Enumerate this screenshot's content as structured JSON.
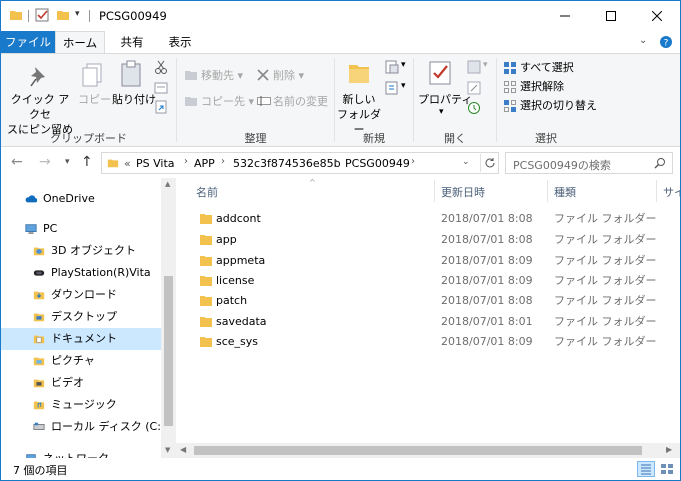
{
  "window": {
    "title": "PCSG00949"
  },
  "tabs": {
    "file": "ファイル",
    "home": "ホーム",
    "share": "共有",
    "view": "表示"
  },
  "ribbon": {
    "clipboard": {
      "pin_line1": "クイック アクセ",
      "pin_line2": "スにピン留め",
      "copy": "コピー",
      "paste": "貼り付け",
      "group": "クリップボード"
    },
    "organize": {
      "move_to": "移動先",
      "delete": "削除",
      "copy_to": "コピー先",
      "rename": "名前の変更",
      "group": "整理"
    },
    "new": {
      "new_folder_line1": "新しい",
      "new_folder_line2": "フォルダー",
      "group": "新規"
    },
    "open": {
      "properties": "プロパティ",
      "group": "開く"
    },
    "select": {
      "select_all": "すべて選択",
      "select_none": "選択解除",
      "invert": "選択の切り替え",
      "group": "選択"
    }
  },
  "address": {
    "overflow": "«",
    "crumbs": [
      "PS Vita",
      "APP",
      "532c3f874536e85b",
      "PCSG00949"
    ],
    "search_placeholder": "PCSG00949の検索"
  },
  "nav": {
    "items": [
      {
        "label": "OneDrive",
        "icon": "cloud-icon"
      },
      {
        "label": "PC",
        "icon": "computer-icon"
      },
      {
        "label": "3D オブジェクト",
        "icon": "3d-objects-icon"
      },
      {
        "label": "PlayStation(R)Vita",
        "icon": "device-icon"
      },
      {
        "label": "ダウンロード",
        "icon": "download-folder-icon"
      },
      {
        "label": "デスクトップ",
        "icon": "desktop-folder-icon"
      },
      {
        "label": "ドキュメント",
        "icon": "documents-folder-icon"
      },
      {
        "label": "ピクチャ",
        "icon": "pictures-folder-icon"
      },
      {
        "label": "ビデオ",
        "icon": "videos-folder-icon"
      },
      {
        "label": "ミュージック",
        "icon": "music-folder-icon"
      },
      {
        "label": "ローカル ディスク (C:)",
        "icon": "drive-icon"
      },
      {
        "label": "ネットワーク",
        "icon": "network-icon"
      }
    ]
  },
  "columns": {
    "name": "名前",
    "date": "更新日時",
    "type": "種類",
    "size": "サイ"
  },
  "files": [
    {
      "name": "addcont",
      "date": "2018/07/01 8:08",
      "type": "ファイル フォルダー"
    },
    {
      "name": "app",
      "date": "2018/07/01 8:08",
      "type": "ファイル フォルダー"
    },
    {
      "name": "appmeta",
      "date": "2018/07/01 8:09",
      "type": "ファイル フォルダー"
    },
    {
      "name": "license",
      "date": "2018/07/01 8:09",
      "type": "ファイル フォルダー"
    },
    {
      "name": "patch",
      "date": "2018/07/01 8:08",
      "type": "ファイル フォルダー"
    },
    {
      "name": "savedata",
      "date": "2018/07/01 8:01",
      "type": "ファイル フォルダー"
    },
    {
      "name": "sce_sys",
      "date": "2018/07/01 8:09",
      "type": "ファイル フォルダー"
    }
  ],
  "status": {
    "count": "7 個の項目"
  },
  "colors": {
    "accent": "#1979ca",
    "folder": "#f2c14e",
    "selected": "#cce8ff"
  }
}
